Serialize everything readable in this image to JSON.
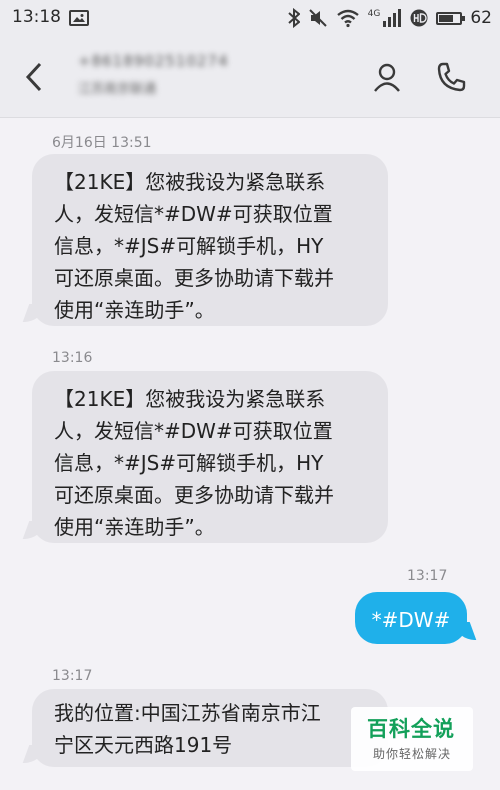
{
  "status_bar": {
    "time": "13:18",
    "battery_level": "62",
    "network_label": "4G",
    "icons": [
      "image-icon",
      "bluetooth-icon",
      "mute-icon",
      "wifi-icon",
      "signal-icon",
      "hd-icon",
      "battery-icon"
    ]
  },
  "header": {
    "contact_number": "+8618902510274",
    "contact_location": "江苏南京联通",
    "icons": [
      "back-arrow-icon",
      "person-icon",
      "phone-icon"
    ]
  },
  "messages": [
    {
      "timestamp": "6月16日 13:51",
      "direction": "incoming",
      "lines": [
        "【21KE】您被我设为紧急联系",
        "人，发短信*#DW#可获取位置",
        "信息，*#JS#可解锁手机，HY",
        "可还原桌面。更多协助请下载并",
        "使用“亲连助手”。"
      ]
    },
    {
      "timestamp": "13:16",
      "direction": "incoming",
      "lines": [
        "【21KE】您被我设为紧急联系",
        "人，发短信*#DW#可获取位置",
        "信息，*#JS#可解锁手机，HY",
        "可还原桌面。更多协助请下载并",
        "使用“亲连助手”。"
      ]
    },
    {
      "timestamp": "13:17",
      "direction": "outgoing",
      "lines": [
        "*#DW#"
      ]
    },
    {
      "timestamp": "13:17",
      "direction": "incoming",
      "lines": [
        "我的位置:中国江苏省南京市江",
        "宁区天元西路191号"
      ]
    }
  ],
  "watermark": {
    "title": "百科全说",
    "subtitle": "助你轻松解决"
  },
  "colors": {
    "outgoing_bubble": "#1fb0ea",
    "incoming_bubble": "#e4e3e8",
    "background": "#f3f2f6",
    "watermark_green": "#13a05a"
  }
}
